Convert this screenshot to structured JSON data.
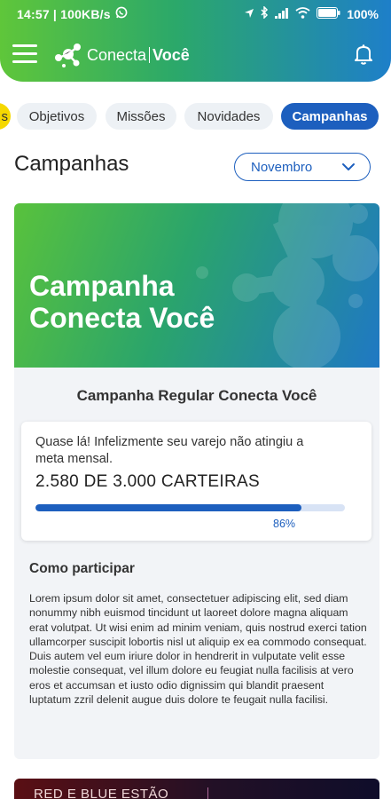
{
  "status_bar": {
    "left": "14:57 | 100KB/s",
    "battery": "100%"
  },
  "app": {
    "logo_part1": "Conecta",
    "logo_part2": "Você"
  },
  "tabs": [
    {
      "label": "s",
      "partial": true
    },
    {
      "label": "Objetivos"
    },
    {
      "label": "Missões"
    },
    {
      "label": "Novidades"
    },
    {
      "label": "Campanhas",
      "active": true
    }
  ],
  "page": {
    "title": "Campanhas",
    "month_selected": "Novembro"
  },
  "campaign": {
    "banner_line1": "Campanha",
    "banner_line2": "Conecta Você",
    "subtitle": "Campanha Regular Conecta Você",
    "progress_message": "Quase lá! Infelizmente seu varejo não atingiu a meta mensal.",
    "progress_count": "2.580 DE 3.000 CARTEIRAS",
    "progress_fraction": 0.86,
    "progress_percent": "86%",
    "how_title": "Como participar",
    "how_body": "Lorem ipsum dolor sit amet, consectetuer adipiscing elit, sed diam nonummy nibh euismod tincidunt ut laoreet dolore magna aliquam erat volutpat. Ut wisi enim ad minim veniam, quis nostrud exerci tation ullamcorper suscipit lobortis nisl ut aliquip ex ea commodo consequat. Duis autem vel eum iriure dolor in hendrerit in vulputate velit esse molestie consequat, vel illum dolore eu feugiat nulla facilisis at vero eros et accumsan et iusto odio dignissim qui blandit praesent luptatum zzril delenit augue duis dolore te feugait nulla facilisi."
  },
  "next_card": {
    "text": "RED E BLUE ESTÃO"
  },
  "colors": {
    "accent": "#1d5fbe",
    "gradient_start": "#5fc63a",
    "gradient_end": "#1e7fc9",
    "tab_partial": "#f5d800"
  },
  "icons": [
    "whatsapp-icon",
    "location-icon",
    "bluetooth-icon",
    "signal-icon",
    "wifi-icon",
    "battery-icon",
    "menu-icon",
    "logo-icon",
    "bell-icon",
    "chevron-down-icon"
  ]
}
